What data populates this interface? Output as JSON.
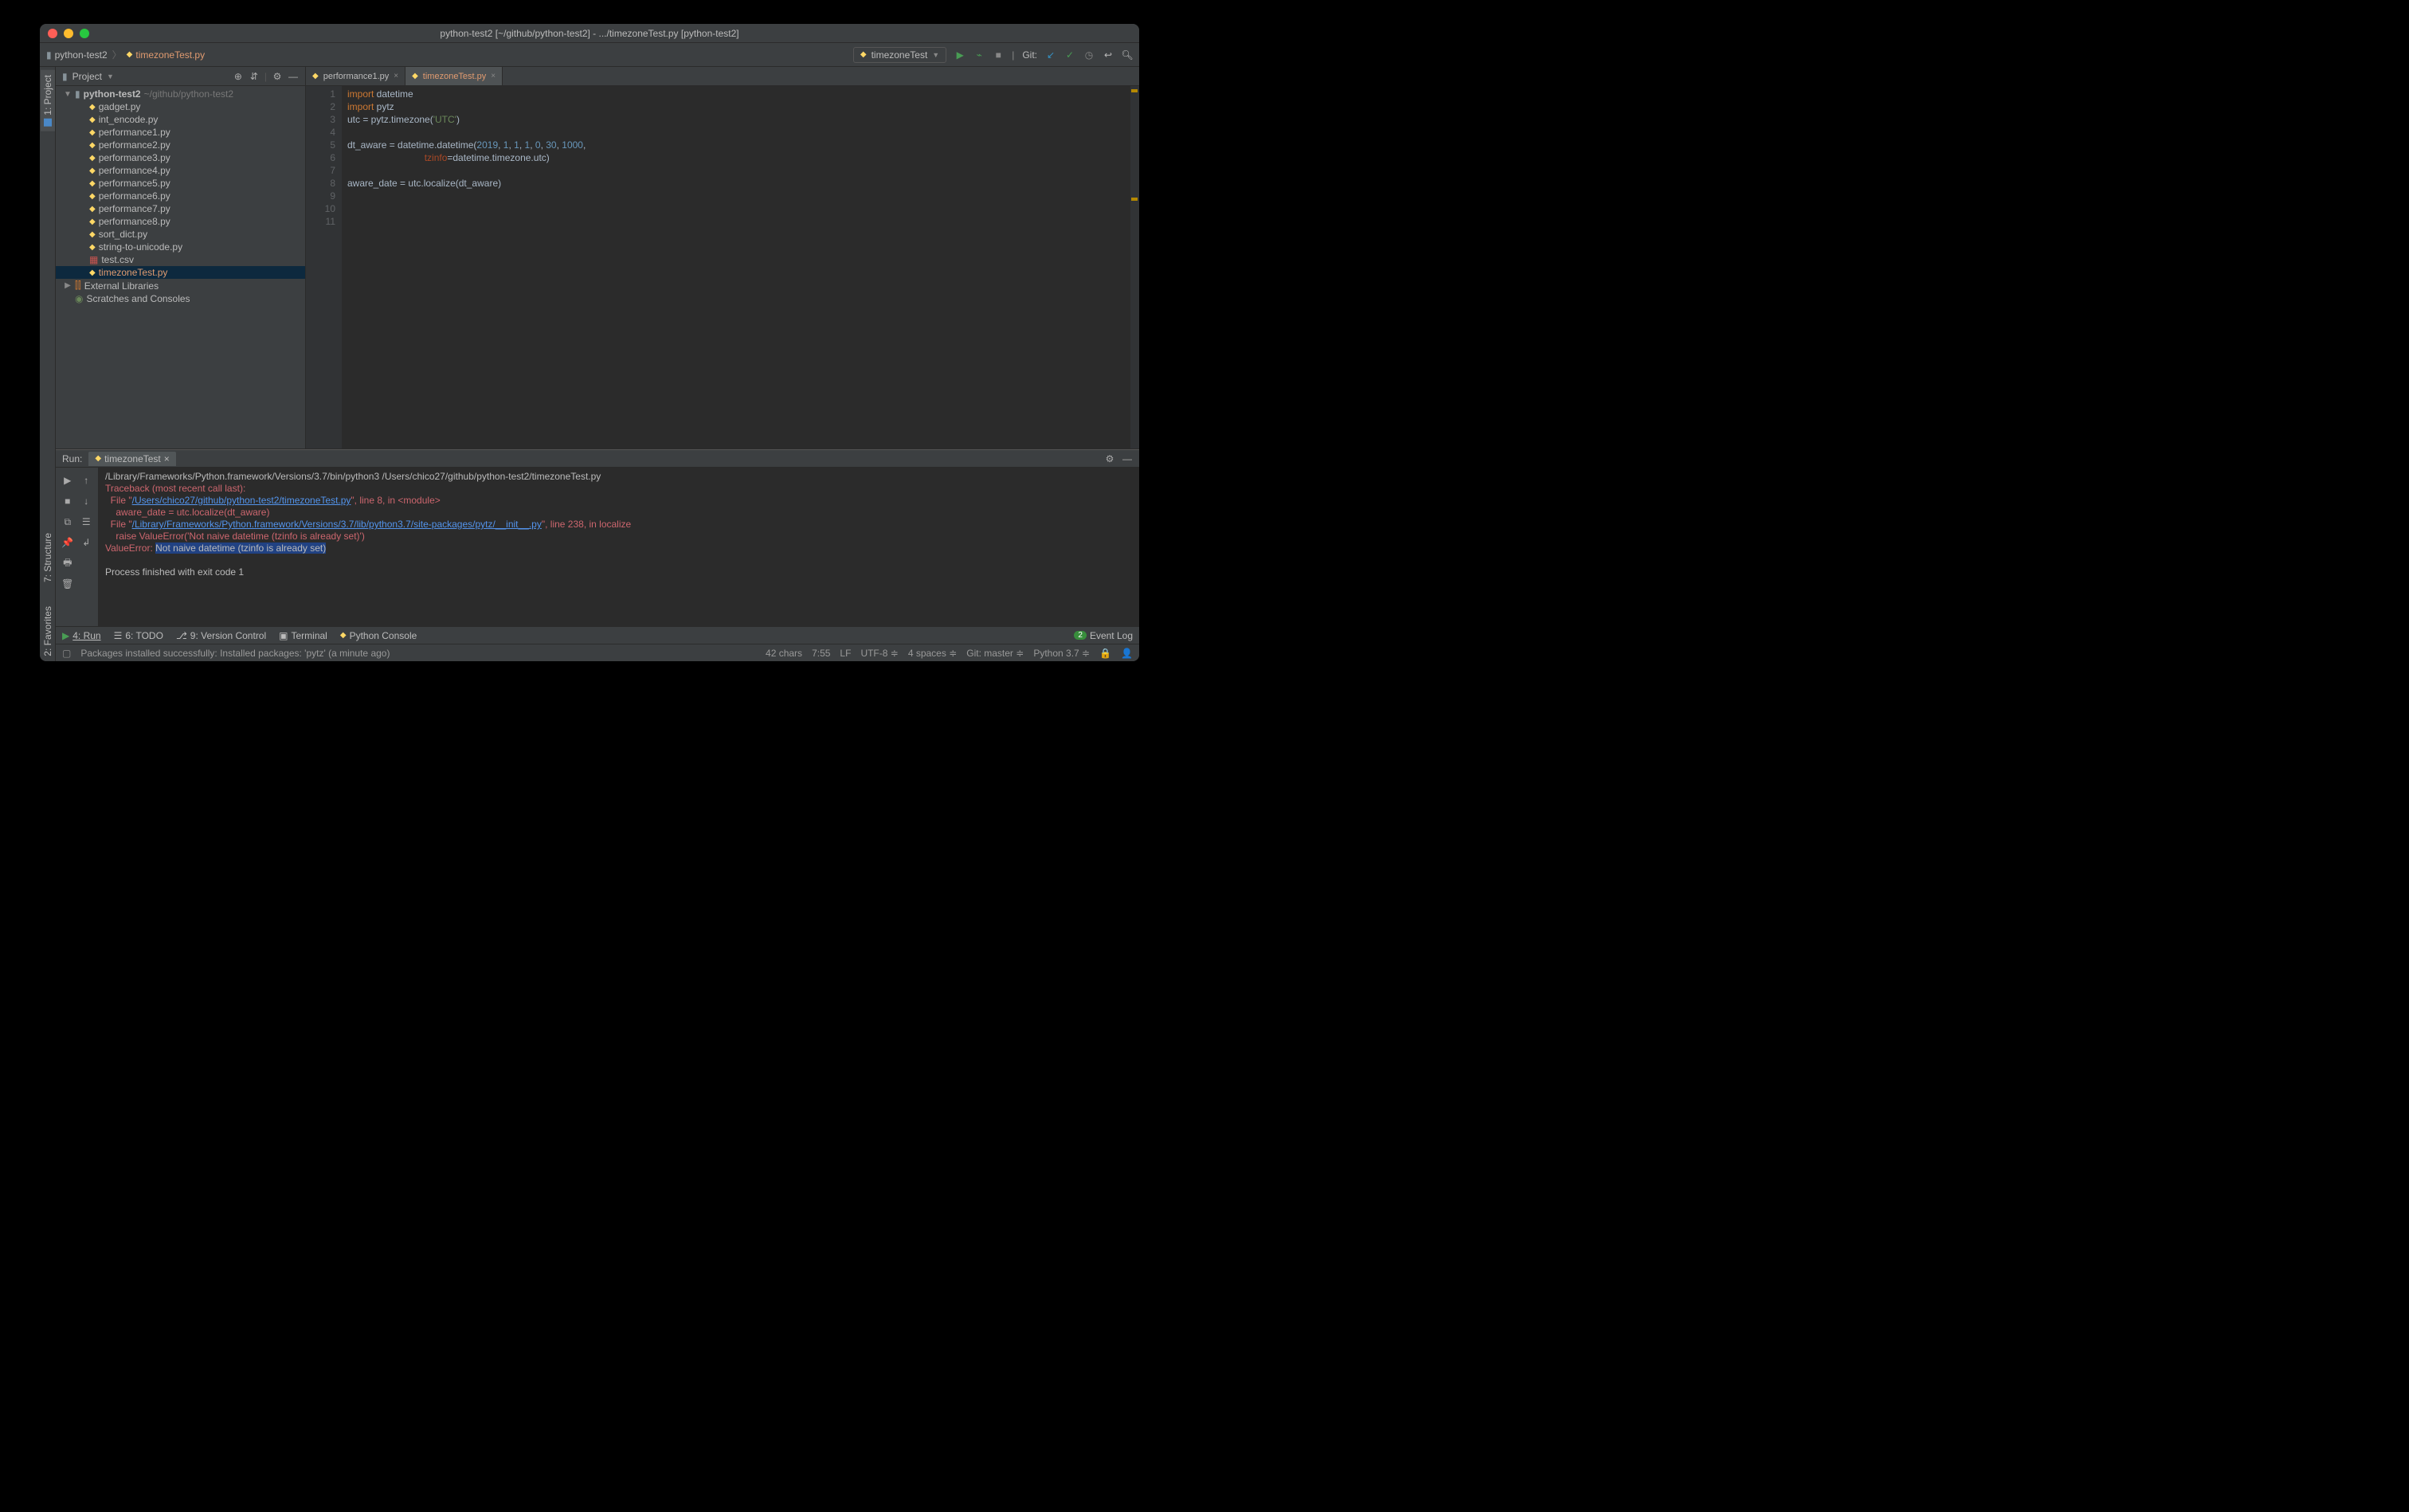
{
  "title": "python-test2 [~/github/python-test2] - .../timezoneTest.py [python-test2]",
  "crumbs": {
    "root": "python-test2",
    "file": "timezoneTest.py"
  },
  "runconfig": "timezoneTest",
  "git_label": "Git:",
  "left_tabs": {
    "project": "1: Project",
    "structure": "7: Structure",
    "favorites": "2: Favorites"
  },
  "project_panel": {
    "label": "Project",
    "root": {
      "name": "python-test2",
      "path": "~/github/python-test2"
    },
    "files": [
      "gadget.py",
      "int_encode.py",
      "performance1.py",
      "performance2.py",
      "performance3.py",
      "performance4.py",
      "performance5.py",
      "performance6.py",
      "performance7.py",
      "performance8.py",
      "sort_dict.py",
      "string-to-unicode.py",
      "test.csv",
      "timezoneTest.py"
    ],
    "selected": "timezoneTest.py",
    "ext_lib": "External Libraries",
    "scratches": "Scratches and Consoles"
  },
  "tabs": [
    {
      "name": "performance1.py",
      "active": false
    },
    {
      "name": "timezoneTest.py",
      "active": true
    }
  ],
  "code": {
    "lines": [
      {
        "n": 1,
        "segs": [
          [
            "kw",
            "import"
          ],
          [
            "",
            " datetime"
          ]
        ]
      },
      {
        "n": 2,
        "segs": [
          [
            "kw",
            "import"
          ],
          [
            "",
            " pytz"
          ]
        ]
      },
      {
        "n": 3,
        "segs": [
          [
            "",
            "utc = pytz.timezone("
          ],
          [
            "str",
            "'UTC'"
          ],
          [
            "",
            ")"
          ]
        ]
      },
      {
        "n": 4,
        "segs": [
          [
            "",
            ""
          ]
        ]
      },
      {
        "n": 5,
        "segs": [
          [
            "",
            "dt_aware = datetime.datetime("
          ],
          [
            "num",
            "2019"
          ],
          [
            "",
            ", "
          ],
          [
            "num",
            "1"
          ],
          [
            "",
            ", "
          ],
          [
            "num",
            "1"
          ],
          [
            "",
            ", "
          ],
          [
            "num",
            "1"
          ],
          [
            "",
            ", "
          ],
          [
            "num",
            "0"
          ],
          [
            "",
            ", "
          ],
          [
            "num",
            "30"
          ],
          [
            "",
            ", "
          ],
          [
            "num",
            "1000"
          ],
          [
            "",
            ","
          ]
        ]
      },
      {
        "n": 6,
        "segs": [
          [
            "",
            "                             "
          ],
          [
            "par",
            "tzinfo"
          ],
          [
            "",
            "=datetime.timezone.utc)"
          ]
        ]
      },
      {
        "n": 7,
        "segs": [
          [
            "",
            ""
          ]
        ]
      },
      {
        "n": 8,
        "segs": [
          [
            "",
            "aware_date = utc.localize(dt_aware)"
          ]
        ]
      },
      {
        "n": 9,
        "segs": [
          [
            "",
            ""
          ]
        ]
      },
      {
        "n": 10,
        "segs": [
          [
            "",
            ""
          ]
        ]
      },
      {
        "n": 11,
        "segs": [
          [
            "",
            ""
          ]
        ]
      }
    ]
  },
  "run": {
    "label": "Run:",
    "tab": "timezoneTest",
    "output": {
      "cmd": "/Library/Frameworks/Python.framework/Versions/3.7/bin/python3 /Users/chico27/github/python-test2/timezoneTest.py",
      "tb_head": "Traceback (most recent call last):",
      "f1a": "  File \"",
      "f1_link": "/Users/chico27/github/python-test2/timezoneTest.py",
      "f1b": "\", line 8, in <module>",
      "l1": "    aware_date = utc.localize(dt_aware)",
      "f2a": "  File \"",
      "f2_link": "/Library/Frameworks/Python.framework/Versions/3.7/lib/python3.7/site-packages/pytz/__init__.py",
      "f2b": "\", line 238, in localize",
      "l2": "    raise ValueError('Not naive datetime (tzinfo is already set)')",
      "ve_a": "ValueError: ",
      "ve_hl": "Not naive datetime (tzinfo is already set)",
      "blank": "",
      "exit": "Process finished with exit code 1"
    }
  },
  "bottom": {
    "run": "4: Run",
    "todo": "6: TODO",
    "vcs": "9: Version Control",
    "terminal": "Terminal",
    "pyconsole": "Python Console",
    "eventlog": "Event Log",
    "event_badge": "2"
  },
  "status": {
    "msg": "Packages installed successfully: Installed packages: 'pytz' (a minute ago)",
    "chars": "42 chars",
    "pos": "7:55",
    "lf": "LF",
    "enc": "UTF-8",
    "indent": "4 spaces",
    "git": "Git: master",
    "py": "Python 3.7"
  }
}
